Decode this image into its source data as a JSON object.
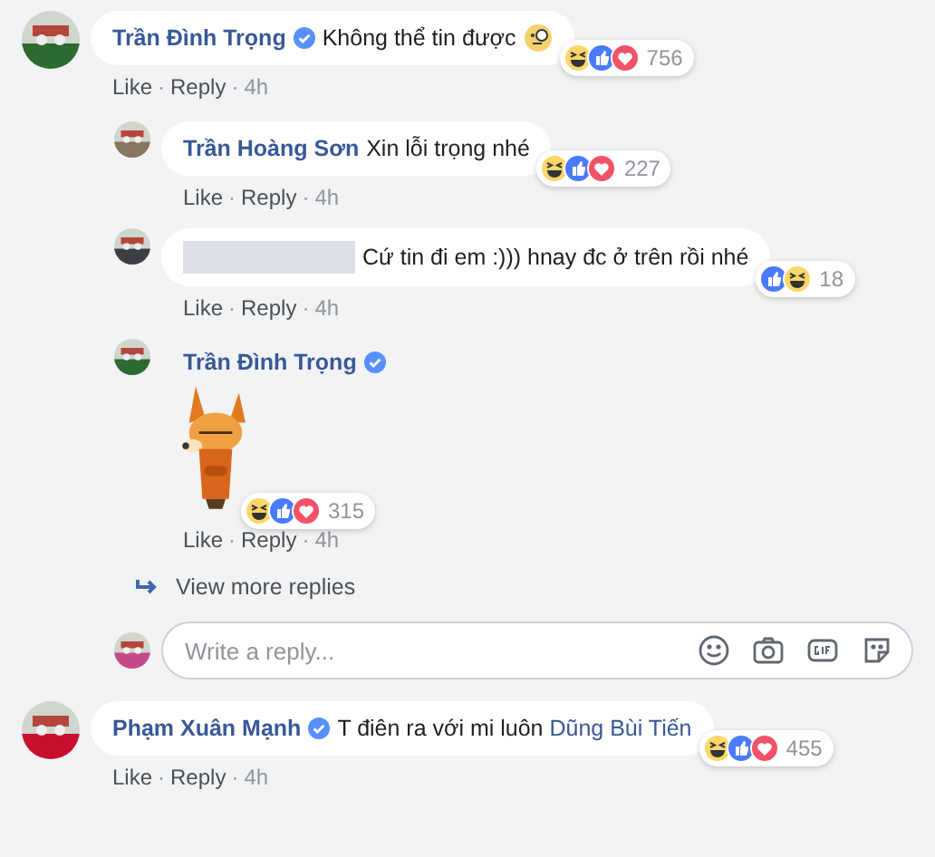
{
  "separator": "·",
  "thread": {
    "author": "Trần Đình Trọng",
    "verified": true,
    "text": "Không thể tin được",
    "emoji": true,
    "reactions": [
      {
        "kind": "haha"
      },
      {
        "kind": "like"
      },
      {
        "kind": "love"
      }
    ],
    "count": "756",
    "actions": [
      "Like",
      "Reply"
    ],
    "time": "4h",
    "children": [
      {
        "author": "Trần Hoàng Sơn",
        "verified": false,
        "text": "Xin lỗi trọng nhé",
        "reactions": [
          {
            "kind": "haha"
          },
          {
            "kind": "like"
          },
          {
            "kind": "love"
          }
        ],
        "count": "227",
        "actions": [
          "Like",
          "Reply"
        ],
        "time": "4h"
      },
      {
        "author_hidden": true,
        "verified": false,
        "text": "Cứ tin đi em :))) hnay đc ở trên rồi nhé",
        "reactions": [
          {
            "kind": "like"
          },
          {
            "kind": "haha"
          }
        ],
        "count": "18",
        "actions": [
          "Like",
          "Reply"
        ],
        "time": "4h"
      },
      {
        "author": "Trần Đình Trọng",
        "verified": true,
        "sticker": true,
        "reactions": [
          {
            "kind": "haha"
          },
          {
            "kind": "like"
          },
          {
            "kind": "love"
          }
        ],
        "count": "315",
        "actions": [
          "Like",
          "Reply"
        ],
        "time": "4h"
      }
    ],
    "more": "View more replies",
    "reply_box": {
      "placeholder": "Write a reply...",
      "tools": [
        {
          "kind": "emoji"
        },
        {
          "kind": "camera"
        },
        {
          "kind": "gif"
        },
        {
          "kind": "sticker"
        }
      ]
    }
  },
  "comment": {
    "author": "Phạm Xuân Mạnh",
    "verified": true,
    "text": "T điên ra với mi luôn ",
    "mention": "Dũng Bùi Tiến",
    "reactions": [
      {
        "kind": "haha"
      },
      {
        "kind": "like"
      },
      {
        "kind": "love"
      }
    ],
    "count": "455",
    "actions": [
      "Like",
      "Reply"
    ],
    "time": "4h"
  }
}
